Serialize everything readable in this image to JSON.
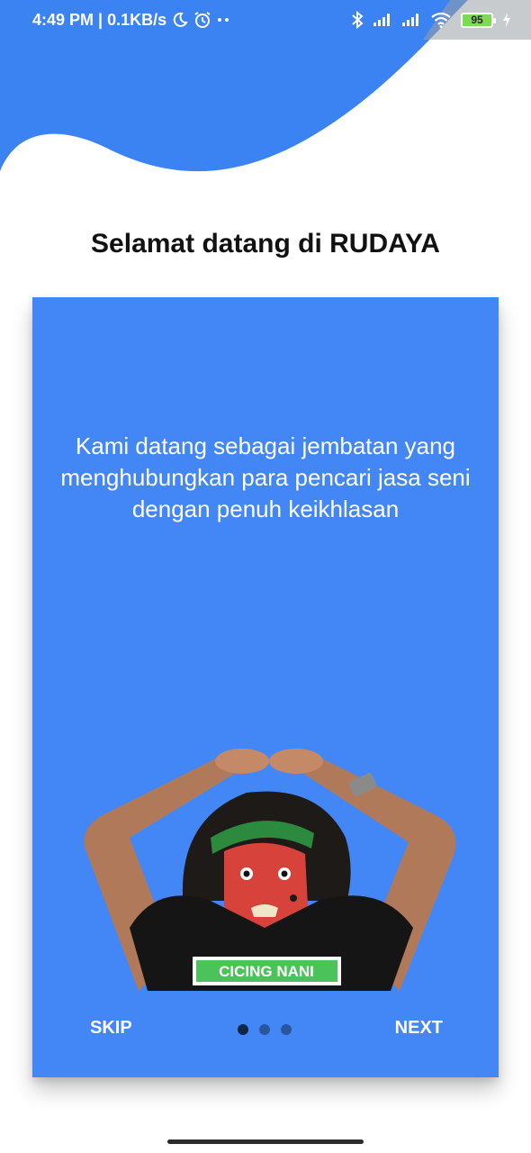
{
  "status_bar": {
    "time_speed": "4:49 PM | 0.1KB/s",
    "battery": "95",
    "icons": [
      "moon-icon",
      "alarm-icon",
      "more-dots-icon",
      "bluetooth-icon",
      "signal-icon",
      "signal-icon",
      "wifi-icon",
      "battery-icon",
      "charging-icon"
    ]
  },
  "header": {
    "title": "Selamat datang di RUDAYA"
  },
  "onboarding": {
    "description": "Kami datang sebagai jembatan yang menghubungkan para pencari jasa seni dengan penuh keikhlasan",
    "shirt_text": "CICING NANI",
    "skip_label": "SKIP",
    "next_label": "NEXT",
    "page_indicator": {
      "total": 3,
      "current": 1
    }
  },
  "colors": {
    "primary": "#4387f7",
    "wave": "#3b82f2",
    "title_text": "#111111"
  }
}
